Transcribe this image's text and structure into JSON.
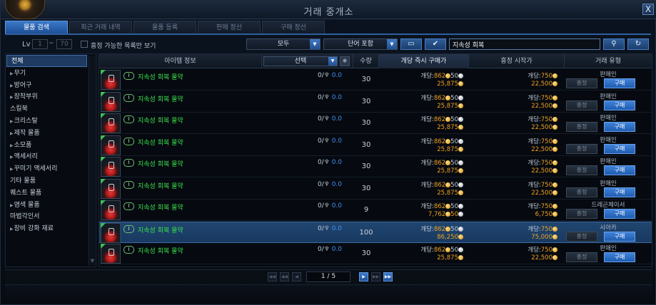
{
  "window": {
    "title": "거래 중개소",
    "close_label": "X"
  },
  "tabs": [
    "물품 검색",
    "최근 거래 내역",
    "물품 등록",
    "판매 정산",
    "구매 정산"
  ],
  "filters": {
    "lv_label": "Lv",
    "lv_min": "1",
    "lv_max": "70",
    "tilde": "~",
    "check_label": "흥정 가능한 목록만 보기",
    "category_select": "모두",
    "word_select": "단어 포함",
    "search_value": "지속성 회복"
  },
  "categories": [
    "전체",
    "무기",
    "방어구",
    "장착부위",
    "스킬북",
    "크리스탈",
    "제작 물품",
    "소모품",
    "액세서리",
    "꾸미기 액세서리",
    "기타 물품",
    "퀘스트 물품",
    "염색 물품",
    "마법각인서",
    "장비 강화 재료"
  ],
  "category_has_arrow": [
    false,
    true,
    true,
    true,
    false,
    true,
    true,
    true,
    true,
    true,
    false,
    false,
    true,
    false,
    true
  ],
  "table": {
    "headers": {
      "item_info": "아이템 정보",
      "select": "선택",
      "qty": "수량",
      "instant_price": "개당 즉시 구매가",
      "bid_start": "흥정 시작가",
      "trade_type": "거래 유형"
    },
    "bid_label": "흥정",
    "buy_label": "구매",
    "per_label": "개당:",
    "rows": [
      {
        "grade": "Ⅰ",
        "name": "지속성 회복 물약",
        "stock": "0/",
        "stock_val": "0.0",
        "qty": "30",
        "unit_gold": "862",
        "unit_silver": "50",
        "total": "25,875",
        "bid_unit": "750",
        "bid_total": "22,500",
        "type": "판매인"
      },
      {
        "grade": "Ⅰ",
        "name": "지속성 회복 물약",
        "stock": "0/",
        "stock_val": "0.0",
        "qty": "30",
        "unit_gold": "862",
        "unit_silver": "50",
        "total": "25,875",
        "bid_unit": "750",
        "bid_total": "22,500",
        "type": "판매인"
      },
      {
        "grade": "Ⅰ",
        "name": "지속성 회복 물약",
        "stock": "0/",
        "stock_val": "0.0",
        "qty": "30",
        "unit_gold": "862",
        "unit_silver": "50",
        "total": "25,875",
        "bid_unit": "750",
        "bid_total": "22,500",
        "type": "판매인"
      },
      {
        "grade": "Ⅰ",
        "name": "지속성 회복 물약",
        "stock": "0/",
        "stock_val": "0.0",
        "qty": "30",
        "unit_gold": "862",
        "unit_silver": "50",
        "total": "25,875",
        "bid_unit": "750",
        "bid_total": "22,500",
        "type": "판매인"
      },
      {
        "grade": "Ⅰ",
        "name": "지속성 회복 물약",
        "stock": "0/",
        "stock_val": "0.0",
        "qty": "30",
        "unit_gold": "862",
        "unit_silver": "50",
        "total": "25,875",
        "bid_unit": "750",
        "bid_total": "22,500",
        "type": "판매인"
      },
      {
        "grade": "Ⅰ",
        "name": "지속성 회복 물약",
        "stock": "0/",
        "stock_val": "0.0",
        "qty": "30",
        "unit_gold": "862",
        "unit_silver": "50",
        "total": "25,875",
        "bid_unit": "750",
        "bid_total": "22,500",
        "type": "판매인"
      },
      {
        "grade": "Ⅰ",
        "name": "지속성 회복 물약",
        "stock": "0/",
        "stock_val": "0.0",
        "qty": "9",
        "unit_gold": "862",
        "unit_silver": "50",
        "total": "7,762",
        "total_silver": "50",
        "bid_unit": "750",
        "bid_total": "6,750",
        "type": "드레곤체이서"
      },
      {
        "grade": "Ⅰ",
        "name": "지속성 회복 물약",
        "stock": "0/",
        "stock_val": "0.0",
        "qty": "100",
        "unit_gold": "862",
        "unit_silver": "50",
        "total": "86,250",
        "bid_unit": "750",
        "bid_total": "75,000",
        "type": "시아카"
      },
      {
        "grade": "Ⅰ",
        "name": "지속성 회복 물약",
        "stock": "0/",
        "stock_val": "0.0",
        "qty": "30",
        "unit_gold": "862",
        "unit_silver": "50",
        "total": "25,875",
        "bid_unit": "750",
        "bid_total": "22,500",
        "type": "판매인"
      }
    ],
    "highlighted_row": 7
  },
  "pager": {
    "page_label": "1 / 5"
  },
  "colors": {
    "accent": "#2f6fc0",
    "item_name": "#39e04b",
    "gold": "#f0a020",
    "stock_value": "#3f8ff0"
  },
  "icons": {
    "close": "close-icon",
    "search": "search-icon",
    "refresh": "refresh-icon",
    "bag": "bag-icon",
    "check": "check-icon",
    "gear": "gear-icon"
  }
}
